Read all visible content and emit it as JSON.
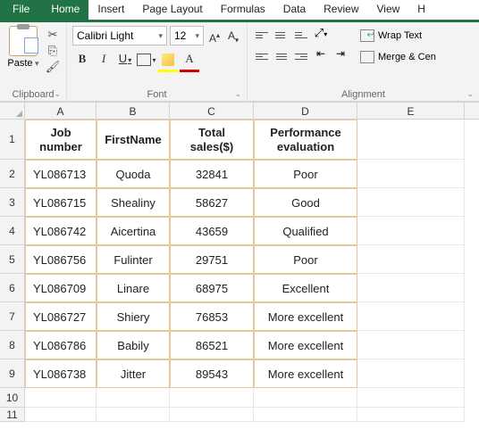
{
  "tabs": {
    "file": "File",
    "items": [
      "Home",
      "Insert",
      "Page Layout",
      "Formulas",
      "Data",
      "Review",
      "View",
      "H"
    ],
    "active": "Home"
  },
  "ribbon": {
    "clipboard": {
      "paste": "Paste",
      "label": "Clipboard"
    },
    "font": {
      "name": "Calibri Light",
      "size": "12",
      "label": "Font"
    },
    "alignment": {
      "wrap": "Wrap Text",
      "merge": "Merge & Cen",
      "label": "Alignment"
    }
  },
  "columns": [
    "A",
    "B",
    "C",
    "D",
    "E"
  ],
  "rownums_header": "1",
  "rownums_data": [
    "2",
    "3",
    "4",
    "5",
    "6",
    "7",
    "8",
    "9"
  ],
  "rownums_empty": [
    "10",
    "11"
  ],
  "headers": {
    "A": "Job number",
    "B": "FirstName",
    "C": "Total sales($)",
    "D": "Performance evaluation"
  },
  "rows": [
    {
      "A": "YL086713",
      "B": "Quoda",
      "C": "32841",
      "D": "Poor"
    },
    {
      "A": "YL086715",
      "B": "Shealiny",
      "C": "58627",
      "D": "Good"
    },
    {
      "A": "YL086742",
      "B": "Aicertina",
      "C": "43659",
      "D": "Qualified"
    },
    {
      "A": "YL086756",
      "B": "Fulinter",
      "C": "29751",
      "D": "Poor"
    },
    {
      "A": "YL086709",
      "B": "Linare",
      "C": "68975",
      "D": "Excellent"
    },
    {
      "A": "YL086727",
      "B": "Shiery",
      "C": "76853",
      "D": "More excellent"
    },
    {
      "A": "YL086786",
      "B": "Babily",
      "C": "86521",
      "D": "More excellent"
    },
    {
      "A": "YL086738",
      "B": "Jitter",
      "C": "89543",
      "D": "More excellent"
    }
  ]
}
